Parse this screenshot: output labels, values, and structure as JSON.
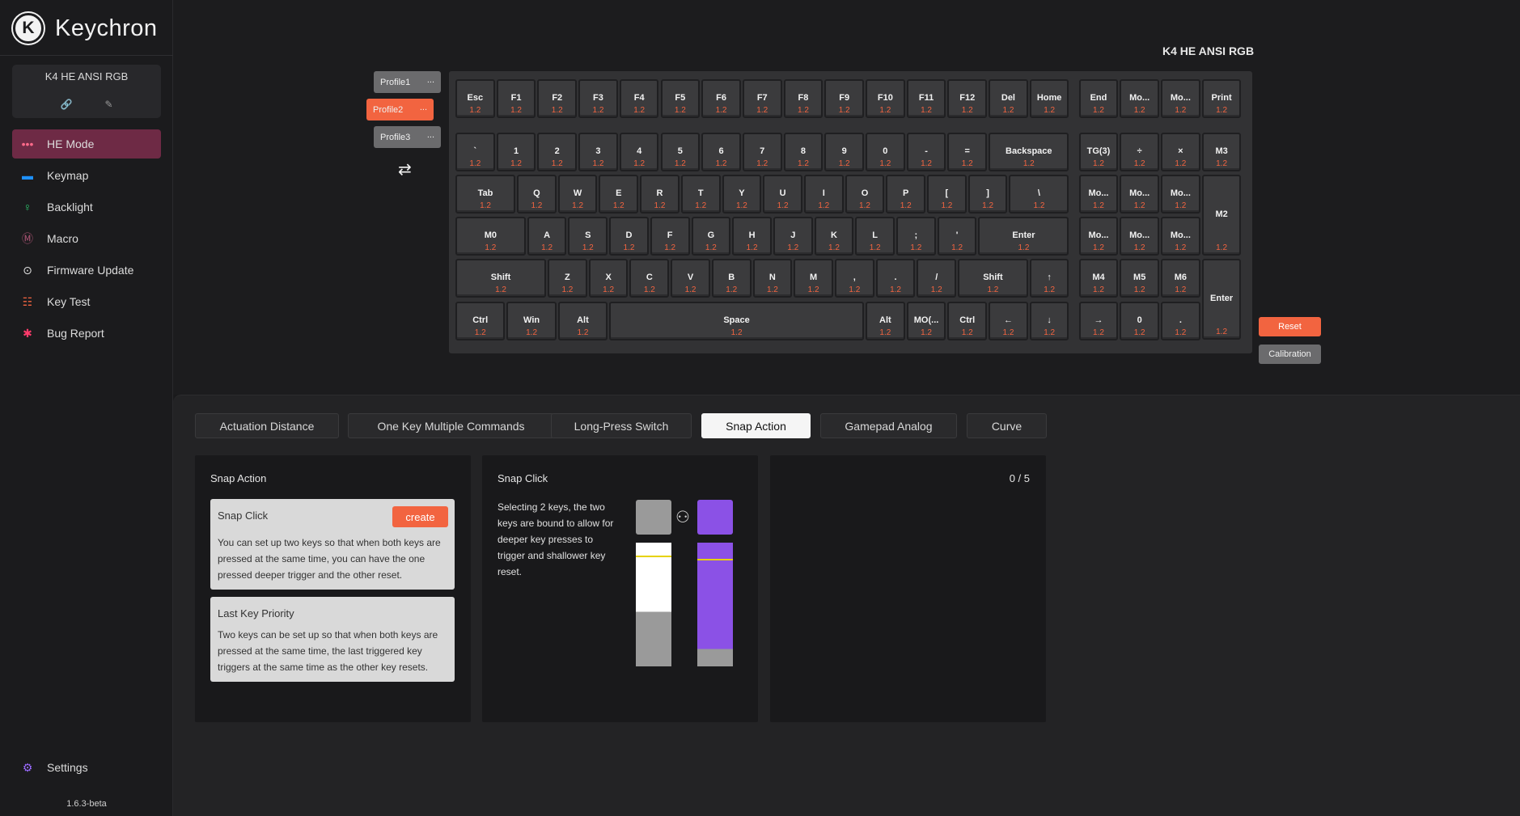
{
  "brand": {
    "logo_letter": "K",
    "name": "Keychron"
  },
  "device": {
    "name": "K4 HE ANSI RGB",
    "action_a": "🔗",
    "action_b": "✎"
  },
  "nav": [
    {
      "id": "he-mode",
      "label": "HE Mode",
      "icon": "•••",
      "color": "#ff6a8a"
    },
    {
      "id": "keymap",
      "label": "Keymap",
      "icon": "▬",
      "color": "#1e90ff"
    },
    {
      "id": "backlight",
      "label": "Backlight",
      "icon": "♀",
      "color": "#2ecc71"
    },
    {
      "id": "macro",
      "label": "Macro",
      "icon": "Ⓜ",
      "color": "#b05577"
    },
    {
      "id": "firmware-update",
      "label": "Firmware Update",
      "icon": "⊙",
      "color": "#e0e0e0"
    },
    {
      "id": "key-test",
      "label": "Key Test",
      "icon": "☷",
      "color": "#f26440"
    },
    {
      "id": "bug-report",
      "label": "Bug Report",
      "icon": "✱",
      "color": "#ff3b6b"
    }
  ],
  "settings": {
    "label": "Settings",
    "icon": "⚙"
  },
  "version": "1.6.3-beta",
  "keyboard_title": "K4 HE ANSI RGB",
  "profiles": [
    {
      "label": "Profile1",
      "more": "..."
    },
    {
      "label": "Profile2",
      "more": "..."
    },
    {
      "label": "Profile3",
      "more": "..."
    }
  ],
  "active_profile": 1,
  "swap_icon": "⇄",
  "keys": [
    [
      "Esc",
      "F1",
      "F2",
      "F3",
      "F4",
      "F5",
      "F6",
      "F7",
      "F8",
      "F9",
      "F10",
      "F11",
      "F12",
      "Del",
      "Home",
      "End",
      "Mo...",
      "Mo...",
      "Print"
    ],
    [
      "`",
      "1",
      "2",
      "3",
      "4",
      "5",
      "6",
      "7",
      "8",
      "9",
      "0",
      "-",
      "=",
      "Backspace",
      "TG(3)",
      "÷",
      "×",
      "M3"
    ],
    [
      "Tab",
      "Q",
      "W",
      "E",
      "R",
      "T",
      "Y",
      "U",
      "I",
      "O",
      "P",
      "[",
      "]",
      "\\",
      "Mo...",
      "Mo...",
      "Mo...",
      "M2"
    ],
    [
      "M0",
      "A",
      "S",
      "D",
      "F",
      "G",
      "H",
      "J",
      "K",
      "L",
      ";",
      "'",
      "Enter",
      "Mo...",
      "Mo...",
      "Mo..."
    ],
    [
      "Shift",
      "Z",
      "X",
      "C",
      "V",
      "B",
      "N",
      "M",
      ",",
      ".",
      "/",
      "Shift",
      "↑",
      "M4",
      "M5",
      "M6",
      "Enter"
    ],
    [
      "Ctrl",
      "Win",
      "Alt",
      "Space",
      "Alt",
      "MO(...",
      "Ctrl",
      "←",
      "↓",
      "→",
      "0",
      "."
    ]
  ],
  "key_value": "1.2",
  "buttons": {
    "reset": "Reset",
    "calibration": "Calibration"
  },
  "tabs": [
    "Actuation Distance",
    "One Key Multiple Commands",
    "Long-Press Switch",
    "Snap Action",
    "Gamepad Analog",
    "Curve"
  ],
  "active_tab": 3,
  "snap_panel": {
    "title": "Snap Action",
    "options": [
      {
        "title": "Snap Click",
        "button": "create",
        "desc": "You can set up two keys so that when both keys are pressed at the same time, you can have the one pressed deeper trigger and the other reset."
      },
      {
        "title": "Last Key Priority",
        "desc": "Two keys can be set up so that when both keys are pressed at the same time, the last triggered key triggers at the same time as the other key resets."
      }
    ]
  },
  "snap_click": {
    "title": "Snap Click",
    "desc": "Selecting 2 keys, the two keys are bound to allow for deeper key presses to trigger and shallower key reset.",
    "link_icon": "⚇",
    "colors": {
      "left": "#9a9a9a",
      "right": "#8b51e6",
      "fill_white": "#ffffff",
      "marker": "#e6d200"
    }
  },
  "counter": "0 / 5"
}
